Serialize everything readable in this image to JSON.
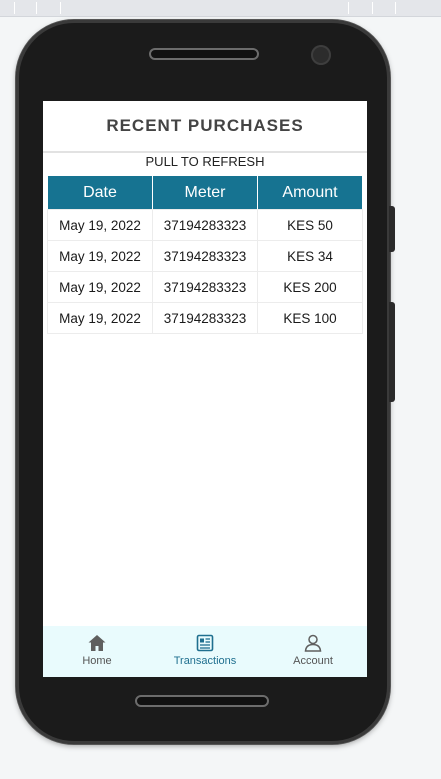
{
  "screen": {
    "title": "RECENT PURCHASES",
    "refresh_hint": "PULL TO REFRESH"
  },
  "table": {
    "headers": [
      "Date",
      "Meter",
      "Amount"
    ],
    "rows": [
      [
        "May 19, 2022",
        "37194283323",
        "KES 50"
      ],
      [
        "May 19, 2022",
        "37194283323",
        "KES 34"
      ],
      [
        "May 19, 2022",
        "37194283323",
        "KES 200"
      ],
      [
        "May 19, 2022",
        "37194283323",
        "KES 100"
      ]
    ]
  },
  "bottom_nav": {
    "items": [
      {
        "label": "Home",
        "icon": "home-icon",
        "active": false
      },
      {
        "label": "Transactions",
        "icon": "receipt-icon",
        "active": true
      },
      {
        "label": "Account",
        "icon": "user-icon",
        "active": false
      }
    ]
  },
  "colors": {
    "table_header_bg": "#167391",
    "active_nav": "#1f6f8f",
    "nav_bg": "#e9fbfd"
  }
}
